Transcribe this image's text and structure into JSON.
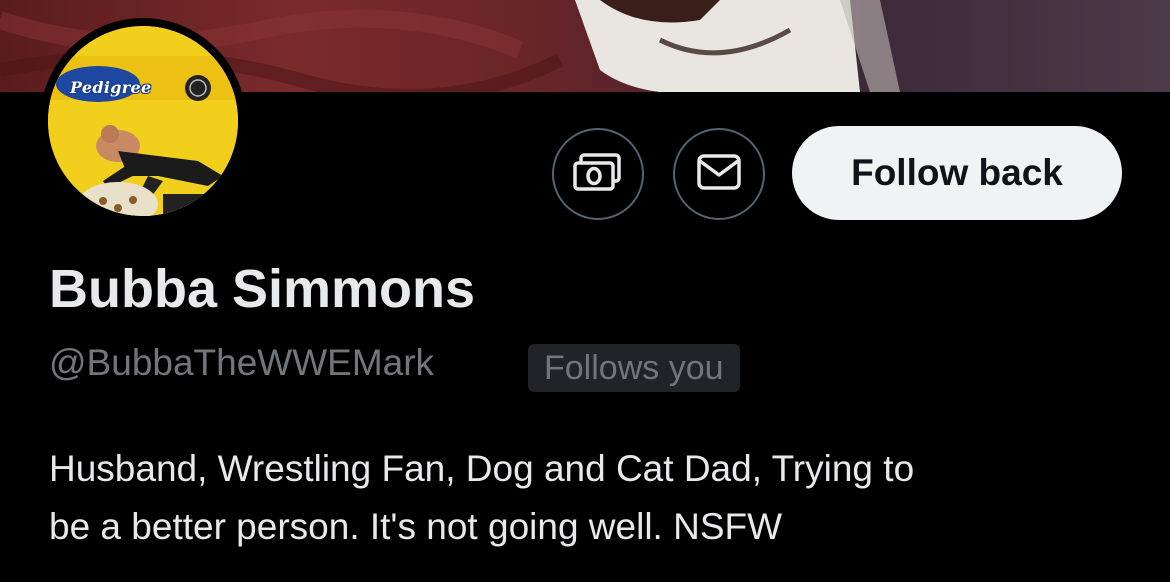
{
  "banner": {
    "image": "dog-photo-banner"
  },
  "avatar": {
    "image": "pedigree-wrestling-avatar",
    "brand_text": "Pedigree"
  },
  "actions": {
    "tip_icon": "money-icon",
    "message_icon": "envelope-icon",
    "follow_label": "Follow back"
  },
  "profile": {
    "display_name": "Bubba Simmons",
    "handle": "@BubbaTheWWEMark",
    "follows_you": "Follows you",
    "bio_line1": "Husband, Wrestling Fan, Dog and Cat Dad, Trying to",
    "bio_line2": "be a better person. It's not going well. NSFW"
  },
  "colors": {
    "background": "#000000",
    "text_primary": "#e7e9ea",
    "text_secondary": "#71767b",
    "button_bg": "#eff3f4",
    "button_text": "#0f1419",
    "border": "#536471",
    "badge_bg": "#202327"
  }
}
